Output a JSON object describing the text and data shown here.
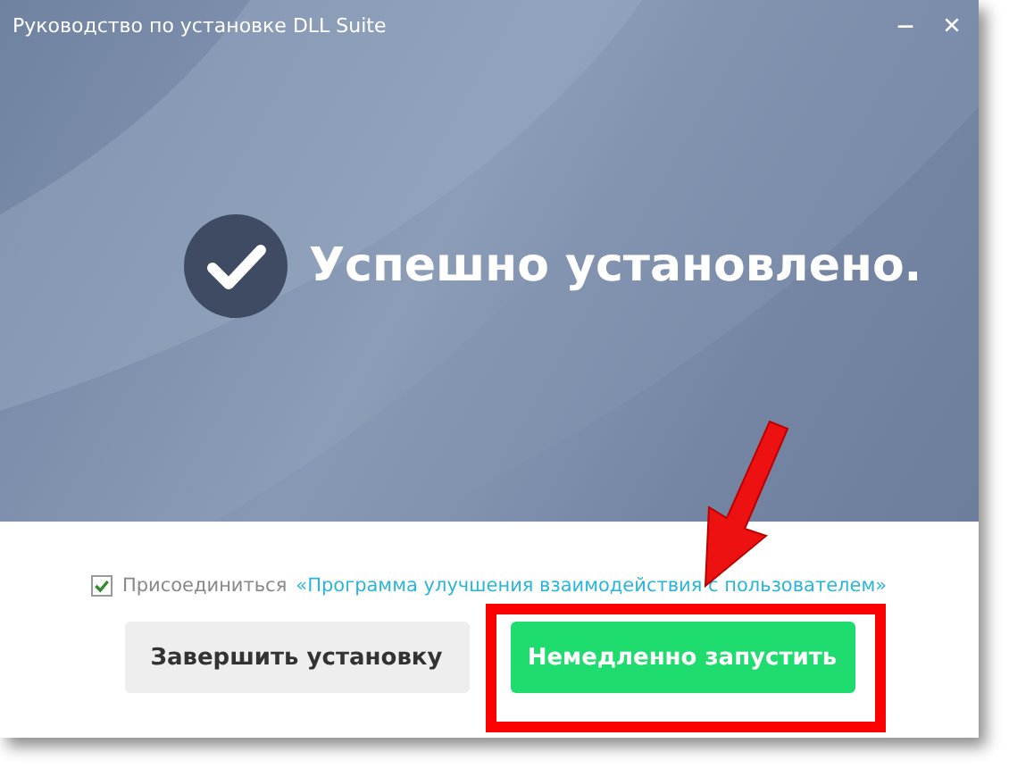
{
  "window": {
    "title": "Руководство по установке DLL Suite"
  },
  "status": {
    "kind": "success",
    "message": "Успешно установлено."
  },
  "consent": {
    "checked": true,
    "label": "Присоединиться",
    "link": "«Программа улучшения взаимодействия с пользователем»"
  },
  "buttons": [
    {
      "label": "Завершить установку",
      "kind": "secondary"
    },
    {
      "label": "Немедленно запустить",
      "kind": "primary",
      "highlighted": true
    }
  ]
}
